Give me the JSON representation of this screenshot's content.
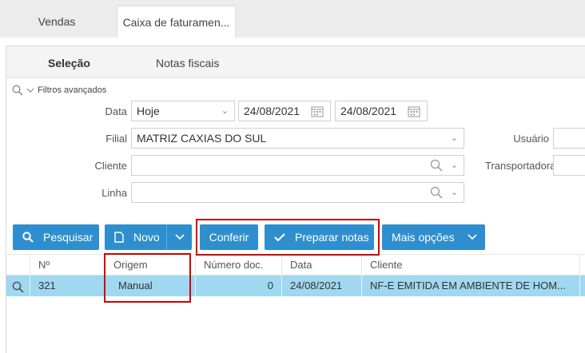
{
  "tabs": {
    "vendas": "Vendas",
    "caixa": "Caixa de faturamen..."
  },
  "subtabs": {
    "selecao": "Seleção",
    "notas": "Notas fiscais"
  },
  "filters": {
    "toggle_label": "Filtros avançados",
    "data_label": "Data",
    "data_select": "Hoje",
    "date_from": "24/08/2021",
    "date_to": "24/08/2021",
    "filial_label": "Filial",
    "filial_value": "MATRIZ CAXIAS DO SUL",
    "cliente_label": "Cliente",
    "cliente_value": "",
    "linha_label": "Linha",
    "linha_value": "",
    "usuario_label": "Usuário",
    "transportadora_label": "Transportadora"
  },
  "toolbar": {
    "pesquisar": "Pesquisar",
    "novo": "Novo",
    "conferir": "Conferir",
    "preparar": "Preparar notas",
    "mais": "Mais opções"
  },
  "grid": {
    "columns": [
      "Nº",
      "Origem",
      "Número doc.",
      "Data",
      "Cliente"
    ],
    "rows": [
      {
        "numero": "321",
        "origem": "Manual",
        "numero_doc": "0",
        "data": "24/08/2021",
        "cliente": "NF-E EMITIDA EM AMBIENTE DE HOM..."
      }
    ]
  },
  "colors": {
    "accent": "#2f8fce",
    "selected_row": "#9fd8f0",
    "highlight": "#d00000"
  }
}
